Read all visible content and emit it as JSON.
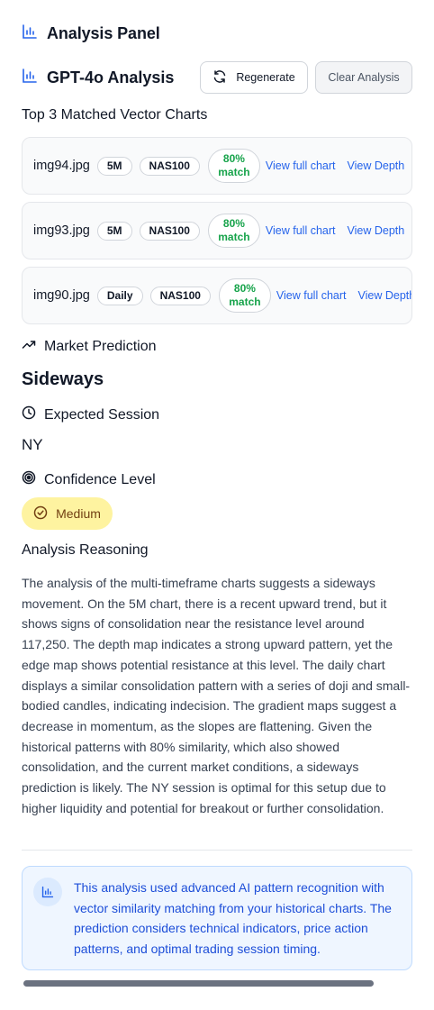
{
  "panel": {
    "title": "Analysis Panel",
    "icon": "bar-chart-icon"
  },
  "analysis": {
    "title": "GPT-4o Analysis",
    "regenerate_label": "Regenerate",
    "clear_label": "Clear Analysis"
  },
  "matched": {
    "title": "Top 3 Matched Vector Charts",
    "items": [
      {
        "file": "img94.jpg",
        "timeframe": "5M",
        "symbol": "NAS100",
        "match_pct": "80%",
        "match_word": "match",
        "view_full": "View full chart",
        "view_depth": "View Depth"
      },
      {
        "file": "img93.jpg",
        "timeframe": "5M",
        "symbol": "NAS100",
        "match_pct": "80%",
        "match_word": "match",
        "view_full": "View full chart",
        "view_depth": "View Depth"
      },
      {
        "file": "img90.jpg",
        "timeframe": "Daily",
        "symbol": "NAS100",
        "match_pct": "80%",
        "match_word": "match",
        "view_full": "View full chart",
        "view_depth": "View Depth"
      }
    ]
  },
  "prediction": {
    "label": "Market Prediction",
    "value": "Sideways"
  },
  "session": {
    "label": "Expected Session",
    "value": "NY"
  },
  "confidence": {
    "label": "Confidence Level",
    "value": "Medium"
  },
  "reasoning": {
    "title": "Analysis Reasoning",
    "text": "The analysis of the multi-timeframe charts suggests a sideways movement. On the 5M chart, there is a recent upward trend, but it shows signs of consolidation near the resistance level around 117,250. The depth map indicates a strong upward pattern, yet the edge map shows potential resistance at this level. The daily chart displays a similar consolidation pattern with a series of doji and small-bodied candles, indicating indecision. The gradient maps suggest a decrease in momentum, as the slopes are flattening. Given the historical patterns with 80% similarity, which also showed consolidation, and the current market conditions, a sideways prediction is likely. The NY session is optimal for this setup due to higher liquidity and potential for breakout or further consolidation."
  },
  "info": {
    "text": "This analysis used advanced AI pattern recognition with vector similarity matching from your historical charts. The prediction considers technical indicators, price action patterns, and optimal trading session timing."
  },
  "colors": {
    "accent": "#2563eb",
    "match_green": "#16a34a",
    "badge_bg": "#fef3a0",
    "info_bg": "#eff6ff"
  }
}
